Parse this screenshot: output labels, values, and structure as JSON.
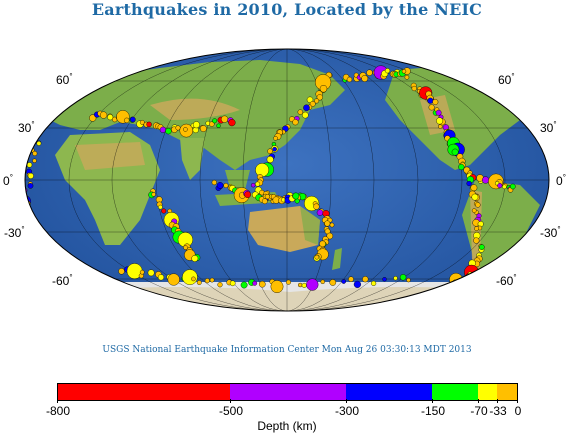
{
  "title": "Earthquakes in 2010, Located by the NEIC",
  "credit": "USGS National Earthquake Information Center Mon Aug 26 03:30:13 MDT 2013",
  "lat_labels": {
    "n60": "60",
    "n30": "30",
    "eq": "0",
    "s30": "-30",
    "s60": "-60",
    "deg": "°"
  },
  "colorbar": {
    "title": "Depth (km)",
    "segments": [
      {
        "from": -800,
        "to": -500,
        "color": "#ff0000"
      },
      {
        "from": -500,
        "to": -300,
        "color": "#b000ff"
      },
      {
        "from": -300,
        "to": -150,
        "color": "#0000ff"
      },
      {
        "from": -150,
        "to": -70,
        "color": "#00ff00"
      },
      {
        "from": -70,
        "to": -33,
        "color": "#ffff00"
      },
      {
        "from": -33,
        "to": 0,
        "color": "#ffbf00"
      }
    ],
    "ticks": [
      "-800",
      "-500",
      "-300",
      "-150",
      "-70",
      "-33",
      "0"
    ]
  },
  "colors": {
    "ocean": "#2a5caa",
    "shallow_ocean": "#5c97d6",
    "land": "#7cae4a",
    "mountain": "#c9a95a",
    "ice": "#e6e6e6",
    "title": "#1f6aa5"
  }
}
